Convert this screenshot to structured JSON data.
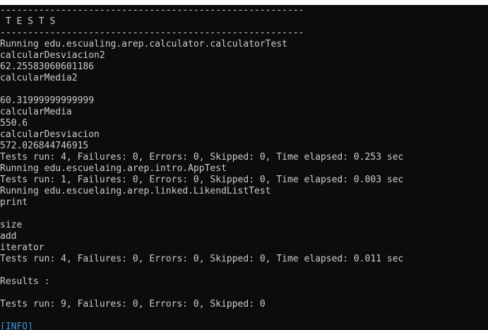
{
  "console": {
    "background": "#0c0c0c",
    "text_color": "#cccccc",
    "info_color": "#3a96dd",
    "lines": [
      "-------------------------------------------------------",
      " T E S T S",
      "-------------------------------------------------------",
      "Running edu.escualing.arep.calculator.calculatorTest",
      "calcularDesviacion2",
      "62.25583060601186",
      "calcularMedia2",
      "",
      "60.31999999999999",
      "calcularMedia",
      "550.6",
      "calcularDesviacion",
      "572.026844746915",
      "Tests run: 4, Failures: 0, Errors: 0, Skipped: 0, Time elapsed: 0.253 sec",
      "Running edu.escuelaing.arep.intro.AppTest",
      "Tests run: 1, Failures: 0, Errors: 0, Skipped: 0, Time elapsed: 0.003 sec",
      "Running edu.escuelaing.arep.linked.LikendListTest",
      "print",
      "",
      "size",
      "add",
      "iterator",
      "Tests run: 4, Failures: 0, Errors: 0, Skipped: 0, Time elapsed: 0.011 sec",
      "",
      "Results :",
      "",
      "Tests run: 9, Failures: 0, Errors: 0, Skipped: 0",
      "",
      "[INFO]"
    ]
  }
}
